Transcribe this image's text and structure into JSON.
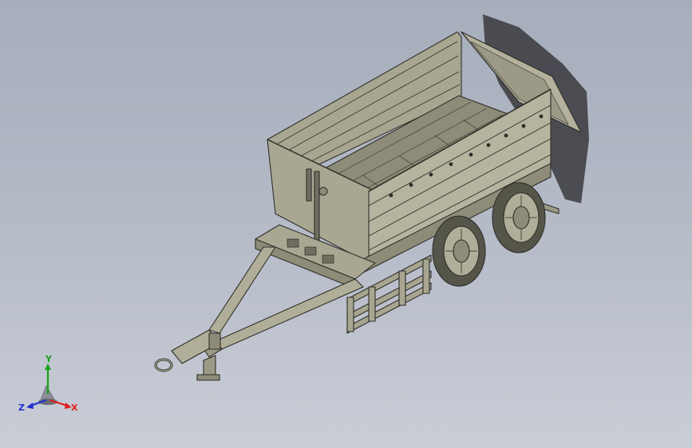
{
  "viewport": {
    "background_top": "#a6adbb",
    "background_bottom": "#c9cdd6"
  },
  "model": {
    "body_color": "#b0ae98",
    "shade_color": "#8e8c78",
    "dark_color": "#55554a",
    "outline_color": "#2f2f2a",
    "shadow_color": "#3a3a3e"
  },
  "triad": {
    "x_label": "X",
    "y_label": "Y",
    "z_label": "Z",
    "x_color": "#e02020",
    "y_color": "#18a018",
    "z_color": "#2030d0"
  }
}
